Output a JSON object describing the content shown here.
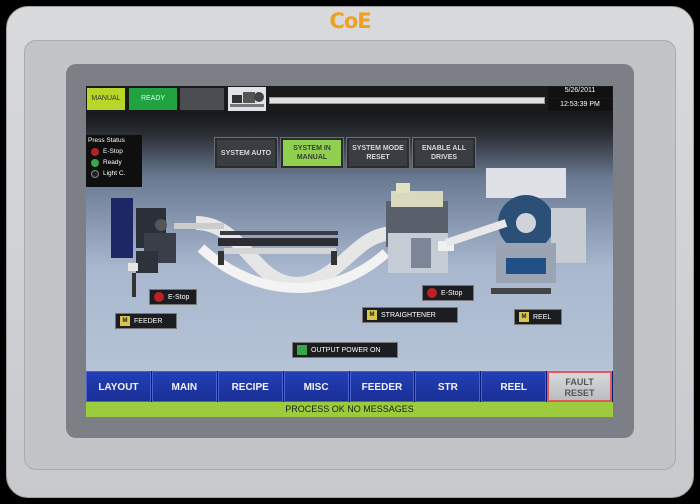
{
  "device": {
    "logo_text": "CoE",
    "colors": {
      "bezel": "#d3d5d8",
      "logo": "#eea01f"
    }
  },
  "top_bar": {
    "mode_manual": "MANUAL",
    "mode_ready": "READY",
    "date": "5/26/2011",
    "time": "12:53:39 PM"
  },
  "press_status": {
    "title": "Press Status",
    "items": [
      {
        "label": "E-Stop",
        "color": "#b22222"
      },
      {
        "label": "Ready",
        "color": "#3aa64c"
      },
      {
        "label": "Light C.",
        "color": "#222222"
      }
    ]
  },
  "controls": {
    "system_auto": "SYSTEM AUTO",
    "system_manual": "SYSTEM IN MANUAL",
    "system_mode_reset": "SYSTEM MODE RESET",
    "enable_all_drives": "ENABLE ALL DRIVES"
  },
  "tags": {
    "feeder_estop": "E-Stop",
    "feeder": "FEEDER",
    "straightener_estop": "E-Stop",
    "straightener": "STRAIGHTENER",
    "reel": "REEL",
    "output_power": "OUTPUT POWER ON",
    "m_badge": "M"
  },
  "nav": {
    "layout": "LAYOUT",
    "main": "MAIN",
    "recipe": "RECIPE",
    "misc": "MISC",
    "feeder": "FEEDER",
    "str": "STR",
    "reel": "REEL",
    "fault_line1": "FAULT",
    "fault_line2": "RESET"
  },
  "status_message": "PROCESS OK NO MESSAGES"
}
